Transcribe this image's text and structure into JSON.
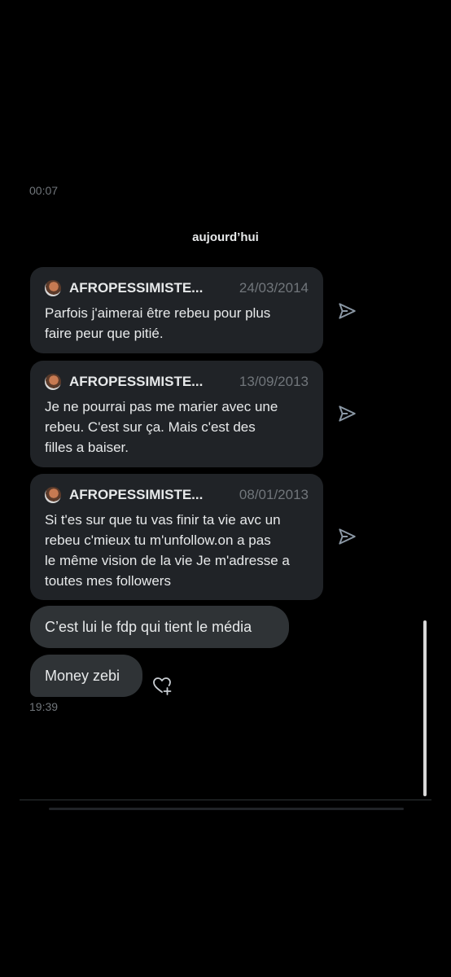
{
  "timestamps": {
    "top": "00:07",
    "bottom": "19:39"
  },
  "day_separator": "aujourd’hui",
  "shared_posts": [
    {
      "author": "AFROPESSIMISTE...",
      "date": "24/03/2014",
      "text_lines": [
        "Parfois j'aimerai être rebeu pour plus",
        "faire peur que pitié."
      ]
    },
    {
      "author": "AFROPESSIMISTE...",
      "date": "13/09/2013",
      "text_lines": [
        "Je ne pourrai pas me marier avec une",
        "rebeu. C'est sur ça. Mais c'est des",
        "filles a baiser."
      ]
    },
    {
      "author": "AFROPESSIMISTE...",
      "date": "08/01/2013",
      "text_lines": [
        "Si t'es sur que tu vas finir ta vie avc un",
        "rebeu c'mieux tu m'unfollow.on a pas",
        "le même vision de la vie Je m'adresse a",
        "toutes mes followers"
      ]
    }
  ],
  "messages": [
    {
      "text": "C’est lui le fdp qui tient le média"
    },
    {
      "text": "Money zebi"
    }
  ],
  "icons": {
    "share": "send-icon",
    "react": "heart-plus-icon"
  },
  "colors": {
    "background": "#000000",
    "card": "#202327",
    "bubble": "#2f3336",
    "muted": "#71767b",
    "text": "#e7e9ea"
  }
}
